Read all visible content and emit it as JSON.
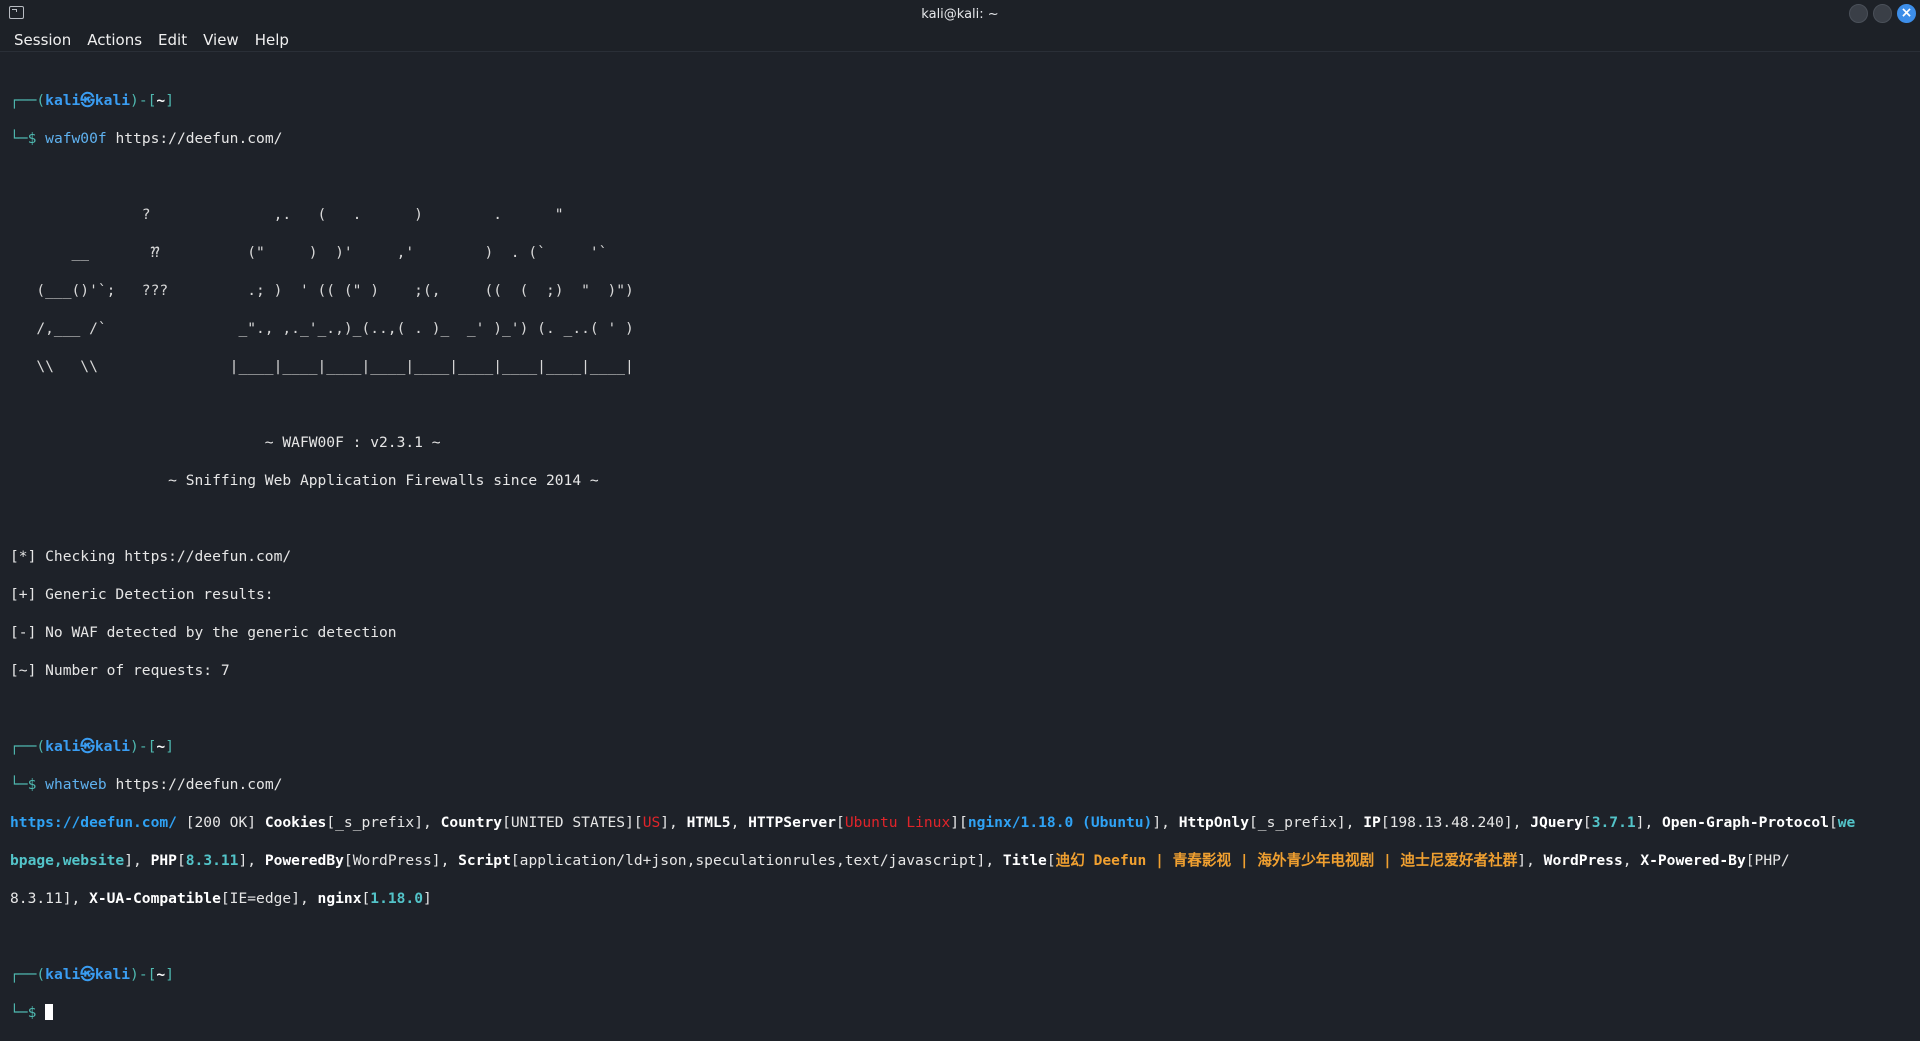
{
  "window": {
    "title": "kali@kali: ~"
  },
  "menu": [
    "Session",
    "Actions",
    "Edit",
    "View",
    "Help"
  ],
  "prompt": {
    "open": "┌──(",
    "user": "kali㉿kali",
    "mid": ")-[",
    "dir": "~",
    "close": "]",
    "arrow": "└─$ "
  },
  "cmd1": {
    "name": "wafw00f",
    "arg": " https://deefun.com/"
  },
  "ascii": [
    "               ?              ,.   (   .      )        .      \"",
    "       __       ⁇          (\"     )  )'     ,'        )  . (`     '`",
    "   (___()'`;   ???         .; )  ' (( (\" )    ;(,     ((  (  ;)  \"  )\")",
    "   /,___ /`               _\"., ,._'_.,)_(..,( . )_  _' )_') (. _..( ' )",
    "   \\\\   \\\\               |____|____|____|____|____|____|____|____|____|"
  ],
  "banner": [
    "                             ~ WAFW00F : v2.3.1 ~",
    "                  ~ Sniffing Web Application Firewalls since 2014 ~"
  ],
  "results": [
    "[*] Checking https://deefun.com/",
    "[+] Generic Detection results:",
    "[-] No WAF detected by the generic detection",
    "[~] Number of requests: 7"
  ],
  "cmd2": {
    "name": "whatweb",
    "arg": " https://deefun.com/"
  },
  "whatweb": {
    "url": "https://deefun.com/",
    "status": " [200 OK] ",
    "cookies": "Cookies",
    "cookies_val": "_s_prefix",
    "country": "Country",
    "country_val": "UNITED STATES",
    "country_code": "US",
    "html5": "HTML5",
    "httpserver": "HTTPServer",
    "os": "Ubuntu Linux",
    "server": "nginx/1.18.0 (Ubuntu)",
    "httponly": "HttpOnly",
    "httponly_val": "_s_prefix",
    "ip": "IP",
    "ip_val": "198.13.48.240",
    "jquery": "JQuery",
    "jquery_val": "3.7.1",
    "og": "Open-Graph-Protocol",
    "og_val_a": "we",
    "og_val_b": "bpage,website",
    "php": "PHP",
    "php_val": "8.3.11",
    "poweredby": "PoweredBy",
    "poweredby_val": "WordPress",
    "script": "Script",
    "script_val": "application/ld+json,speculationrules,text/javascript",
    "title": "Title",
    "title_val": "迪幻 Deefun | 青春影视 | 海外青少年电视剧 | 迪士尼爱好者社群",
    "wordpress": "WordPress",
    "xpb": "X-Powered-By",
    "xpb_val_a": "PHP/",
    "xpb_val_b": "8.3.11",
    "xua": "X-UA-Compatible",
    "xua_val": "IE=edge",
    "nginx": "nginx",
    "nginx_val": "1.18.0"
  }
}
